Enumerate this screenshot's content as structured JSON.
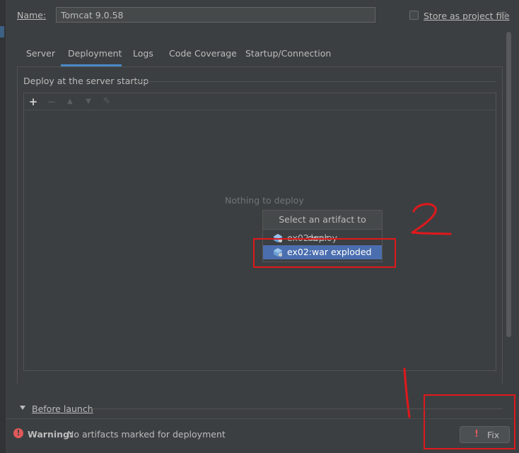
{
  "config": {
    "name_label": "Name:",
    "name_value": "Tomcat 9.0.58",
    "store_label": "Store as project file",
    "store_checked": false
  },
  "tabs": [
    {
      "label": "Server",
      "active": false
    },
    {
      "label": "Deployment",
      "active": true
    },
    {
      "label": "Logs",
      "active": false
    },
    {
      "label": "Code Coverage",
      "active": false
    },
    {
      "label": "Startup/Connection",
      "active": false
    }
  ],
  "deploy": {
    "group_title": "Deploy at the server startup",
    "toolbar_icons": [
      "add-icon",
      "remove-icon",
      "move-up-icon",
      "move-down-icon",
      "edit-icon"
    ],
    "empty_text": "Nothing to deploy"
  },
  "popup": {
    "title": "Select an artifact to deploy",
    "items": [
      {
        "label": "ex02:war",
        "icon": "artifact-icon",
        "selected": false
      },
      {
        "label": "ex02:war exploded",
        "icon": "artifact-icon",
        "selected": true
      }
    ]
  },
  "before_launch": {
    "label": "Before launch"
  },
  "warning": {
    "bold": "Warning:",
    "text": "No artifacts marked for deployment"
  },
  "fix_button": {
    "label": "Fix"
  },
  "annotations": {
    "label_1": "2",
    "color": "#e0181c"
  },
  "colors": {
    "accent": "#4a88c7",
    "selection": "#4b6eaf",
    "error": "#e0595b",
    "background": "#3c3f41"
  }
}
